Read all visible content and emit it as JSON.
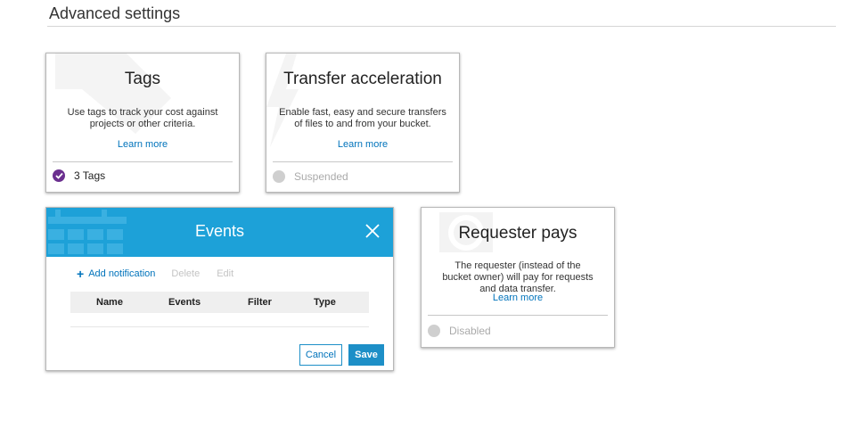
{
  "section": {
    "title": "Advanced settings"
  },
  "tags_card": {
    "title": "Tags",
    "description": "Use tags to track your cost against projects or other criteria.",
    "link": "Learn more",
    "status": "3 Tags"
  },
  "transfer_card": {
    "title": "Transfer acceleration",
    "description": "Enable fast, easy and secure transfers of files to and from your bucket.",
    "link": "Learn more",
    "status": "Suspended"
  },
  "events_panel": {
    "title": "Events",
    "toolbar": {
      "add": "Add notification",
      "delete": "Delete",
      "edit": "Edit"
    },
    "columns": [
      "Name",
      "Events",
      "Filter",
      "Type"
    ],
    "cancel": "Cancel",
    "save": "Save"
  },
  "requester_card": {
    "title": "Requester pays",
    "description": "The requester (instead of the bucket owner) will pay for requests and data transfer.",
    "link": "Learn more",
    "status": "Disabled"
  },
  "colors": {
    "accent_blue": "#1da1d8",
    "link_blue": "#0073bb",
    "enabled_purple": "#6b2f8f",
    "disabled_gray": "#cfcfcf"
  },
  "icons": {
    "tags_card": "tag-icon",
    "transfer_card": "lightning-icon",
    "events_panel": "calendar-icon",
    "requester_card": "coin-icon",
    "enabled_status": "check-icon",
    "close": "close-icon",
    "add": "plus-icon"
  }
}
